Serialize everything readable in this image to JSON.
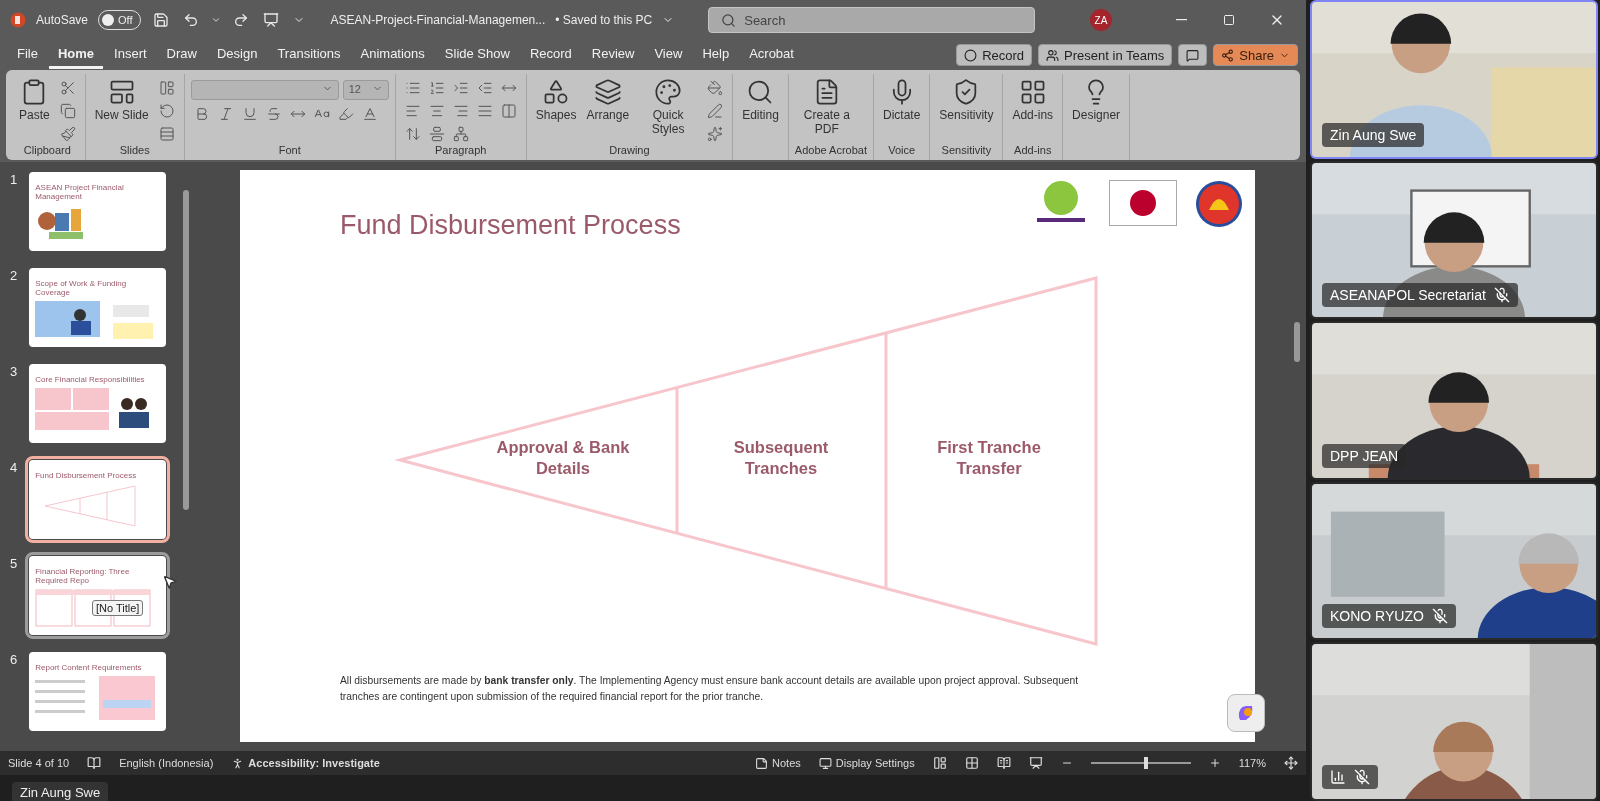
{
  "titlebar": {
    "autosave_label": "AutoSave",
    "autosave": {
      "on": false,
      "label": "Off"
    },
    "filename": "ASEAN-Project-Financial-Managemen...",
    "save_status": "• Saved to this PC",
    "search": {
      "placeholder": "Search"
    },
    "avatar": "ZA"
  },
  "ribbon_tabs": [
    {
      "label": "File",
      "selected": false
    },
    {
      "label": "Home",
      "selected": true
    },
    {
      "label": "Insert",
      "selected": false
    },
    {
      "label": "Draw",
      "selected": false
    },
    {
      "label": "Design",
      "selected": false
    },
    {
      "label": "Transitions",
      "selected": false
    },
    {
      "label": "Animations",
      "selected": false
    },
    {
      "label": "Slide Show",
      "selected": false
    },
    {
      "label": "Record",
      "selected": false
    },
    {
      "label": "Review",
      "selected": false
    },
    {
      "label": "View",
      "selected": false
    },
    {
      "label": "Help",
      "selected": false
    },
    {
      "label": "Acrobat",
      "selected": false
    }
  ],
  "ribbon_actions": [
    {
      "kind": "record",
      "label": "Record"
    },
    {
      "kind": "teams",
      "label": "Present in Teams"
    },
    {
      "kind": "comment"
    },
    {
      "kind": "share",
      "label": "Share"
    }
  ],
  "ribbon_groups": [
    {
      "label": "Clipboard",
      "buttons": [
        "Paste"
      ]
    },
    {
      "label": "Slides",
      "buttons": [
        "New Slide"
      ]
    },
    {
      "label": "Font",
      "font_size": "12"
    },
    {
      "label": "Paragraph"
    },
    {
      "label": "Drawing",
      "buttons": [
        "Shapes",
        "Arrange",
        "Quick Styles"
      ]
    },
    {
      "buttons": [
        "Editing"
      ]
    },
    {
      "label": "Adobe Acrobat",
      "buttons": [
        "Create a PDF"
      ]
    },
    {
      "label": "Voice",
      "buttons": [
        "Dictate"
      ]
    },
    {
      "label": "Sensitivity",
      "buttons": [
        "Sensitivity"
      ]
    },
    {
      "label": "Add-ins",
      "buttons": [
        "Add-ins"
      ]
    },
    {
      "buttons": [
        "Designer"
      ]
    }
  ],
  "thumbnails": [
    {
      "number": "1",
      "title": "ASEAN Project Financial Management",
      "kind": "cover",
      "selected": false,
      "hovered": false
    },
    {
      "number": "2",
      "title": "Scope of Work & Funding Coverage",
      "selected": false,
      "hovered": false
    },
    {
      "number": "3",
      "title": "Core Financial Responsibilities",
      "kind": "cards",
      "selected": false,
      "hovered": false
    },
    {
      "number": "4",
      "title": "Fund Disbursement Process",
      "kind": "funnel",
      "selected": true,
      "hovered": false
    },
    {
      "number": "5",
      "title": "Financial Reporting: Three Required Repo",
      "kind": "columns",
      "selected": false,
      "hovered": true
    },
    {
      "number": "6",
      "title": "Report Content Requirements",
      "kind": "list",
      "selected": false,
      "hovered": false
    }
  ],
  "tooltip": "[No Title]",
  "slide": {
    "title": "Fund Disbursement Process",
    "stages": [
      "Approval & Bank Details",
      "Subsequent Tranches",
      "First Tranche Transfer"
    ],
    "note": "All disbursements are made by **bank transfer only**. The Implementing Agency must ensure bank account details are available upon project approval. Subsequent tranches are contingent upon submission of the required financial report for the prior tranche."
  },
  "status_bar": {
    "slide": "Slide 4 of 10",
    "language": "English (Indonesia)",
    "accessibility": "Accessibility: Investigate",
    "notes": "Notes",
    "display_settings": "Display Settings",
    "zoom_slider": {
      "level": 0.55
    },
    "zoom": "117%"
  },
  "caption": "Zin Aung Swe",
  "participants": [
    {
      "name": "Zin Aung Swe",
      "muted": false,
      "speaking": true
    },
    {
      "name": "ASEANAPOL Secretariat",
      "muted": true,
      "speaking": false
    },
    {
      "name": "DPP JEAN",
      "muted": false,
      "speaking": false
    },
    {
      "name": "KONO RYUZO",
      "muted": true,
      "speaking": false
    },
    {
      "muted": true,
      "speaking": false
    }
  ]
}
